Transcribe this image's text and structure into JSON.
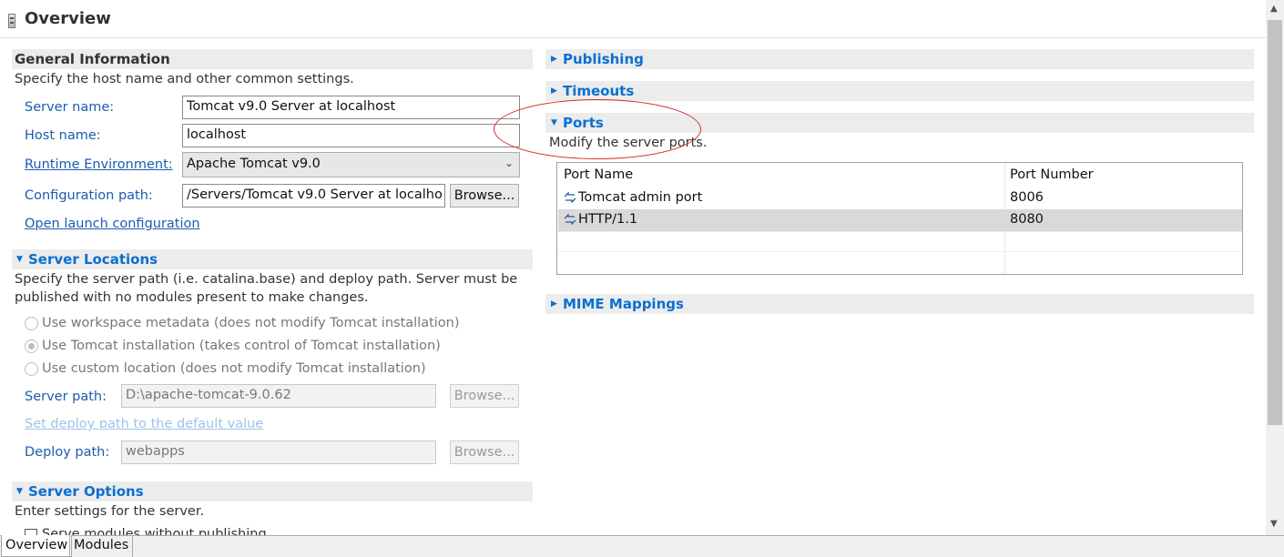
{
  "header": {
    "title": "Overview"
  },
  "general": {
    "title": "General Information",
    "description": "Specify the host name and other common settings.",
    "server_name_label": "Server name:",
    "server_name_value": "Tomcat v9.0 Server at localhost",
    "host_name_label": "Host name:",
    "host_name_value": "localhost",
    "runtime_label": "Runtime Environment:",
    "runtime_value": "Apache Tomcat v9.0",
    "config_path_label": "Configuration path:",
    "config_path_value": "/Servers/Tomcat v9.0 Server at localho",
    "browse_label": "Browse...",
    "open_launch_label": "Open launch configuration"
  },
  "locations": {
    "title": "Server Locations",
    "description_line1": "Specify the server path (i.e. catalina.base) and deploy path. Server must be",
    "description_line2": "published with no modules present to make changes.",
    "options": [
      {
        "label": "Use workspace metadata (does not modify Tomcat installation)",
        "checked": false
      },
      {
        "label": "Use Tomcat installation (takes control of Tomcat installation)",
        "checked": true
      },
      {
        "label": "Use custom location (does not modify Tomcat installation)",
        "checked": false
      }
    ],
    "server_path_label": "Server path:",
    "server_path_value": "D:\\apache-tomcat-9.0.62",
    "browse_label": "Browse...",
    "set_default_label": "Set deploy path to the default value",
    "deploy_path_label": "Deploy path:",
    "deploy_path_value": "webapps"
  },
  "options": {
    "title": "Server Options",
    "description": "Enter settings for the server.",
    "first_checkbox_label": "Serve modules without publishing"
  },
  "right": {
    "publishing_title": "Publishing",
    "timeouts_title": "Timeouts",
    "ports_title": "Ports",
    "ports_description": "Modify the server ports.",
    "ports_table": {
      "col_name": "Port Name",
      "col_number": "Port Number",
      "rows": [
        {
          "name": "Tomcat admin port",
          "number": "8006",
          "selected": false
        },
        {
          "name": "HTTP/1.1",
          "number": "8080",
          "selected": true
        }
      ]
    },
    "mime_title": "MIME Mappings"
  },
  "tabs": {
    "overview": "Overview",
    "modules": "Modules"
  },
  "colors": {
    "link": "#0a6fd1",
    "annotation": "#d42b2b",
    "section_bg": "#ececec"
  },
  "icons": {
    "editor": "server-editor-icon",
    "port": "port-icon"
  }
}
